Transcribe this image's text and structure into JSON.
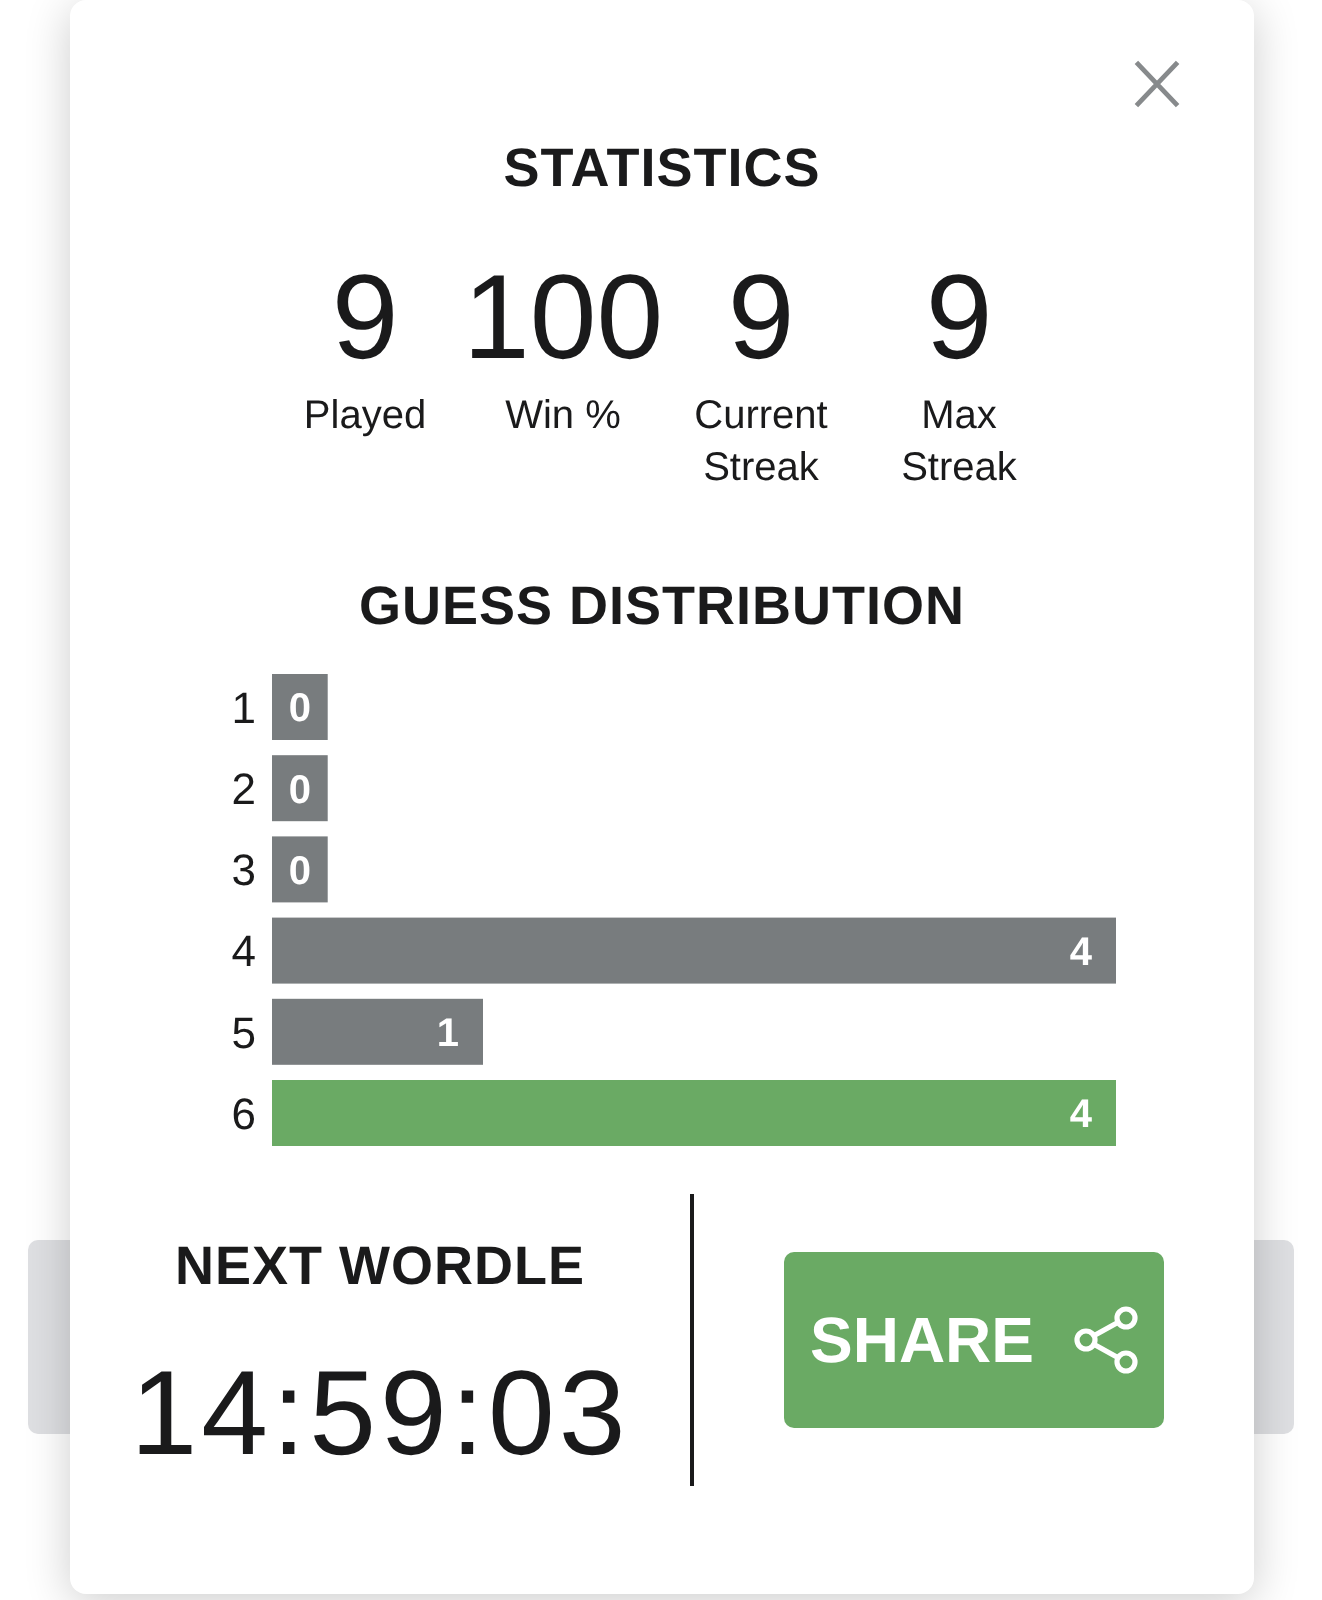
{
  "statistics": {
    "heading": "STATISTICS",
    "items": [
      {
        "value": "9",
        "label": "Played"
      },
      {
        "value": "100",
        "label": "Win %"
      },
      {
        "value": "9",
        "label": "Current Streak"
      },
      {
        "value": "9",
        "label": "Max Streak"
      }
    ]
  },
  "guess_distribution": {
    "heading": "GUESS DISTRIBUTION",
    "chart_data": {
      "type": "bar",
      "orientation": "horizontal",
      "categories": [
        "1",
        "2",
        "3",
        "4",
        "5",
        "6"
      ],
      "series": [
        {
          "color": "#787c7e",
          "values": [
            0,
            0,
            0,
            4,
            1,
            null
          ]
        },
        {
          "color": "#6aaa64",
          "values": [
            null,
            null,
            null,
            null,
            null,
            4
          ]
        }
      ],
      "data_labels": true
    }
  },
  "next_wordle": {
    "heading": "NEXT WORDLE",
    "countdown": "14:59:03"
  },
  "share_button": {
    "label": "SHARE"
  }
}
